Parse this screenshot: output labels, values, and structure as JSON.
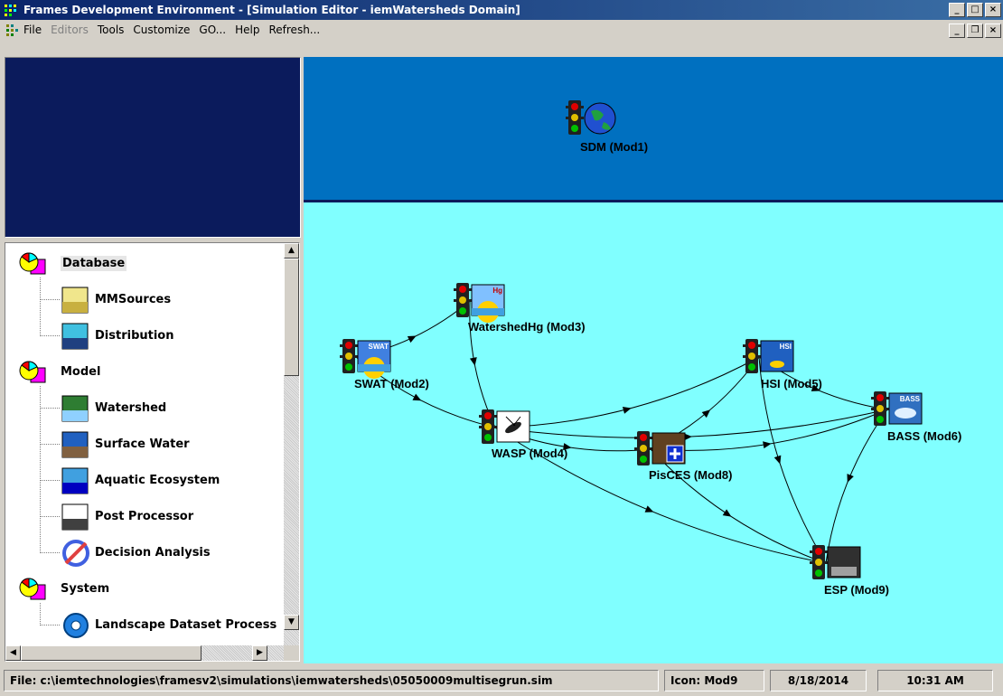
{
  "window": {
    "title": "Frames Development Environment - [Simulation Editor - iemWatersheds Domain]"
  },
  "menu": [
    {
      "label": "File",
      "enabled": true
    },
    {
      "label": "Editors",
      "enabled": false
    },
    {
      "label": "Tools",
      "enabled": true
    },
    {
      "label": "Customize",
      "enabled": true
    },
    {
      "label": "GO...",
      "enabled": true
    },
    {
      "label": "Help",
      "enabled": true
    },
    {
      "label": "Refresh...",
      "enabled": true
    }
  ],
  "tree": {
    "groups": [
      {
        "label": "Database",
        "icon": "database-group-icon",
        "selected": true,
        "items": [
          {
            "label": "MMSources",
            "icon": "mmsources-icon"
          },
          {
            "label": "Distribution",
            "icon": "distribution-icon"
          }
        ]
      },
      {
        "label": "Model",
        "icon": "model-group-icon",
        "items": [
          {
            "label": "Watershed",
            "icon": "watershed-icon"
          },
          {
            "label": "Surface Water",
            "icon": "surface-water-icon"
          },
          {
            "label": "Aquatic Ecosystem",
            "icon": "aquatic-ecosystem-icon"
          },
          {
            "label": "Post Processor",
            "icon": "post-processor-icon"
          },
          {
            "label": "Decision Analysis",
            "icon": "decision-analysis-icon"
          }
        ]
      },
      {
        "label": "System",
        "icon": "system-group-icon",
        "items": [
          {
            "label": "Landscape Dataset Process",
            "icon": "gear-icon"
          }
        ]
      }
    ]
  },
  "modules": [
    {
      "id": "Mod1",
      "label": "SDM (Mod1)",
      "icon": "globe-icon"
    },
    {
      "id": "Mod2",
      "label": "SWAT (Mod2)",
      "icon": "swat-icon",
      "badge": "SWAT"
    },
    {
      "id": "Mod3",
      "label": "WatershedHg (Mod3)",
      "icon": "watershedhg-icon",
      "badge": "Hg"
    },
    {
      "id": "Mod4",
      "label": "WASP (Mod4)",
      "icon": "wasp-icon"
    },
    {
      "id": "Mod5",
      "label": "HSI (Mod5)",
      "icon": "hsi-icon",
      "badge": "HSI"
    },
    {
      "id": "Mod6",
      "label": "BASS (Mod6)",
      "icon": "bass-icon",
      "badge": "BASS"
    },
    {
      "id": "Mod8",
      "label": "PisCES (Mod8)",
      "icon": "pisces-icon"
    },
    {
      "id": "Mod9",
      "label": "ESP (Mod9)",
      "icon": "esp-icon"
    }
  ],
  "connections": [
    [
      "Mod2",
      "Mod3"
    ],
    [
      "Mod2",
      "Mod4"
    ],
    [
      "Mod3",
      "Mod4"
    ],
    [
      "Mod4",
      "Mod5"
    ],
    [
      "Mod4",
      "Mod6"
    ],
    [
      "Mod4",
      "Mod8"
    ],
    [
      "Mod4",
      "Mod9"
    ],
    [
      "Mod8",
      "Mod5"
    ],
    [
      "Mod8",
      "Mod6"
    ],
    [
      "Mod8",
      "Mod9"
    ],
    [
      "Mod5",
      "Mod6"
    ],
    [
      "Mod5",
      "Mod9"
    ],
    [
      "Mod6",
      "Mod9"
    ]
  ],
  "colors": {
    "top_panel": "#0070c0",
    "model_area": "#80ffff",
    "left_top": "#0b1b5c"
  },
  "status": {
    "file": "File: c:\\iemtechnologies\\framesv2\\simulations\\iemwatersheds\\05050009multisegrun.sim",
    "icon": "Icon: Mod9",
    "date": "8/18/2014",
    "time": "10:31 AM"
  }
}
